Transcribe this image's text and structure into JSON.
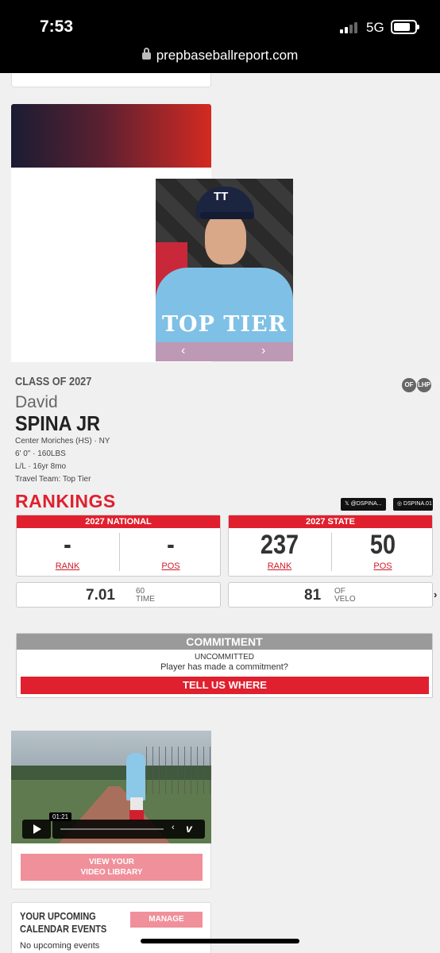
{
  "status_bar": {
    "time": "7:53",
    "network": "5G",
    "url": "prepbaseballreport.com"
  },
  "photo": {
    "cap_logo": "TT",
    "shirt_text": "TOP TIER",
    "prev": "‹",
    "next": "›"
  },
  "player": {
    "class_of": "CLASS OF 2027",
    "positions": [
      "OF",
      "LHP"
    ],
    "first_name": "David",
    "last_name": "SPINA JR",
    "school": "Center Moriches (HS) · NY",
    "size": "6' 0\" · 160LBS",
    "bats_age": "L/L · 16yr 8mo",
    "travel_team": "Travel Team: Top Tier"
  },
  "rankings": {
    "title": "RANKINGS",
    "twitter": "𝕏 @DSPINA...",
    "instagram": "◎ DSPINA.01",
    "national": {
      "header": "2027 NATIONAL",
      "rank": "-",
      "pos": "-",
      "rank_label": "RANK",
      "pos_label": "POS"
    },
    "state": {
      "header": "2027 STATE",
      "rank": "237",
      "pos": "50",
      "rank_label": "RANK",
      "pos_label": "POS"
    }
  },
  "stats": [
    {
      "value": "7.01",
      "label_top": "60",
      "label_bottom": "TIME"
    },
    {
      "value": "81",
      "label_top": "OF",
      "label_bottom": "VELO"
    }
  ],
  "next_chevron": "›",
  "commitment": {
    "header": "COMMITMENT",
    "status": "UNCOMMITTED",
    "prompt": "Player has made a commitment?",
    "button": "TELL US WHERE"
  },
  "video": {
    "timestamp": "01:21",
    "share": "‹",
    "provider": "v",
    "library_line1": "VIEW YOUR",
    "library_line2": "VIDEO LIBRARY"
  },
  "calendar": {
    "title": "YOUR UPCOMING CALENDAR EVENTS",
    "button": "MANAGE CALENDAR",
    "empty": "No upcoming events"
  }
}
